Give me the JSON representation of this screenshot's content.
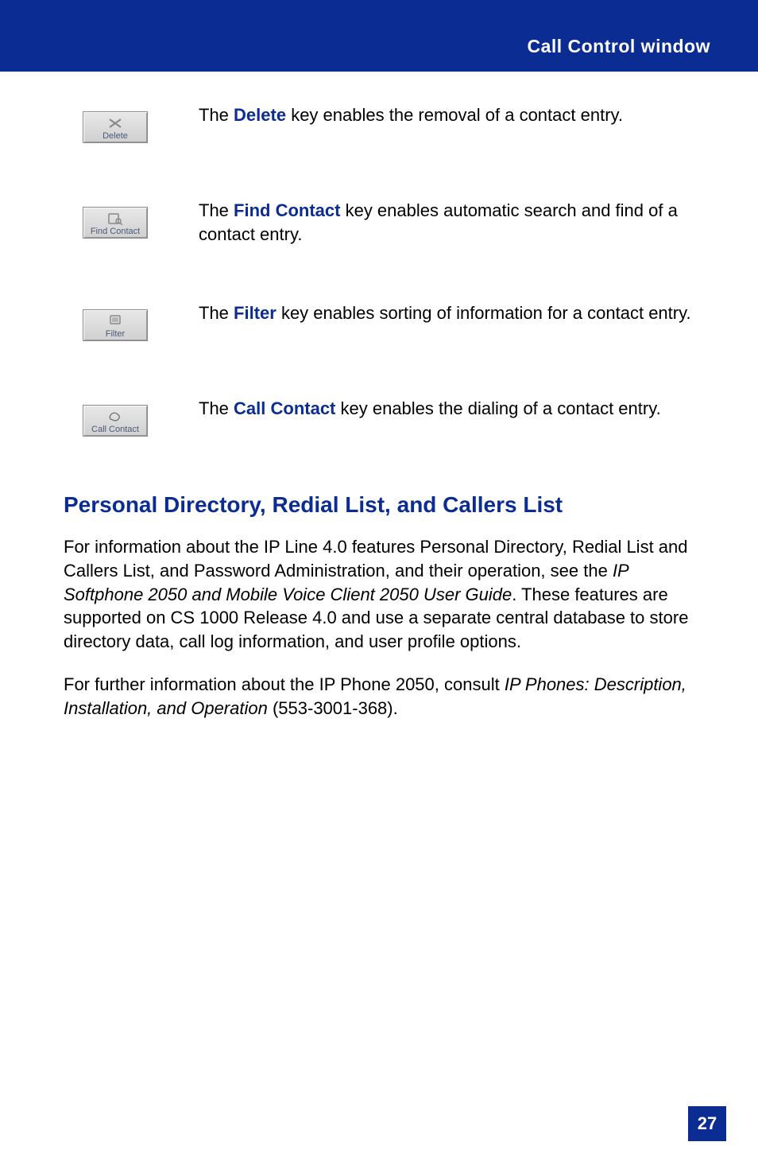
{
  "header": {
    "title": "Call Control window"
  },
  "keys": [
    {
      "button_caption": "Delete",
      "desc_prefix": "The ",
      "desc_bold": "Delete",
      "desc_suffix": " key enables the removal of a contact entry."
    },
    {
      "button_caption": "Find Contact",
      "desc_prefix": "The ",
      "desc_bold": "Find Contact",
      "desc_suffix": " key enables automatic search and find of a contact entry."
    },
    {
      "button_caption": "Filter",
      "desc_prefix": "The ",
      "desc_bold": "Filter",
      "desc_suffix": " key enables sorting of information for a contact entry."
    },
    {
      "button_caption": "Call Contact",
      "desc_prefix": "The ",
      "desc_bold": "Call Contact",
      "desc_suffix": " key enables the dialing of a contact entry."
    }
  ],
  "section": {
    "heading": "Personal Directory, Redial List, and Callers List",
    "para1_a": "For information about the IP Line 4.0 features Personal Directory, Redial List and Callers List, and Password Administration, and their operation, see the ",
    "para1_italic": "IP Softphone 2050 and Mobile Voice Client 2050 User Guide",
    "para1_b": ". These features are supported on CS 1000 Release 4.0 and use a separate central database to store directory data, call log information, and user profile options.",
    "para2_a": "For further information about the IP Phone 2050, consult ",
    "para2_italic": "IP Phones: Description, Installation, and Operation",
    "para2_b": " (553-3001-368)."
  },
  "page_number": "27"
}
